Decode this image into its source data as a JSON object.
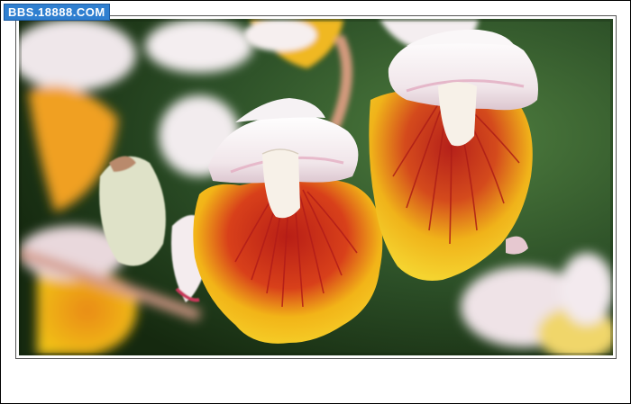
{
  "watermark": {
    "text": "BBS.18888.COM"
  },
  "photo": {
    "subject": "ginger-flower-blossoms",
    "colors": {
      "background_dark": "#1e3a1b",
      "background_mid": "#3f6a34",
      "petal_white": "#f6eef0",
      "petal_pink_tint": "#e5b8c8",
      "lip_yellow": "#f2c418",
      "lip_orange": "#e98a12",
      "vein_red": "#c4281c",
      "stem_pink": "#d8988e"
    }
  }
}
